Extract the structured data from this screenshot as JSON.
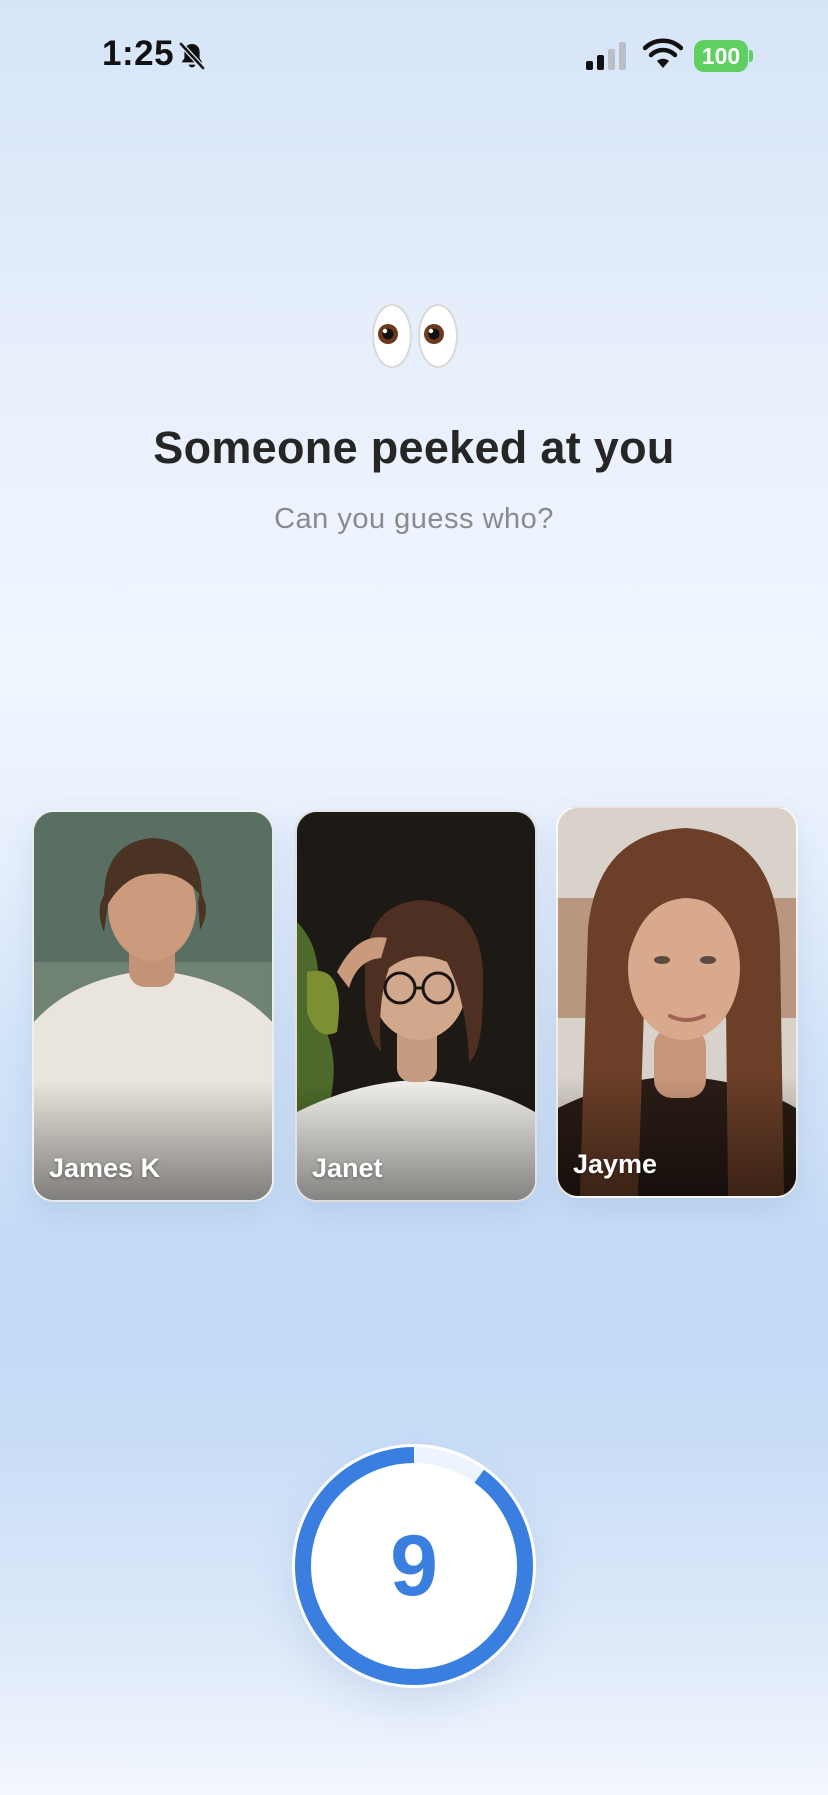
{
  "status_bar": {
    "time": "1:25",
    "battery": "100",
    "icons": [
      "bell-slash-icon",
      "cellular-signal-icon",
      "wifi-icon",
      "battery-icon"
    ]
  },
  "header": {
    "emoji": "👀",
    "title": "Someone peeked at you",
    "subtitle": "Can you guess who?"
  },
  "cards": [
    {
      "name": "James K"
    },
    {
      "name": "Janet"
    },
    {
      "name": "Jayme"
    }
  ],
  "timer": {
    "value": "9",
    "progress": 0.9,
    "ring_color": "#3a7fe0",
    "track_color": "#eef4fd"
  },
  "colors": {
    "accent": "#3a7fe0",
    "battery": "#5fcf62"
  }
}
